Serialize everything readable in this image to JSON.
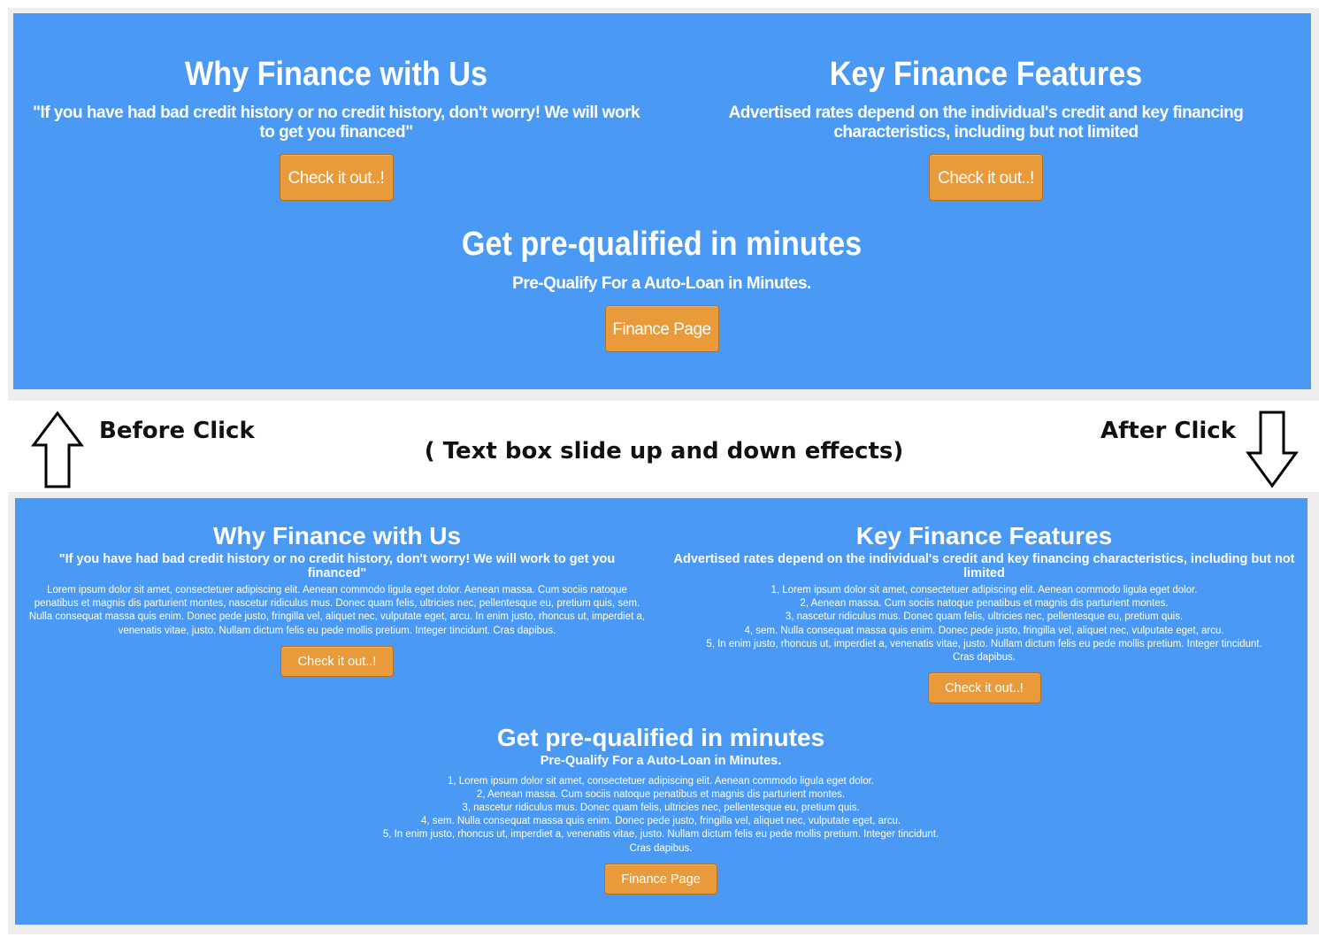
{
  "before_panel": {
    "left": {
      "title": "Why Finance with Us",
      "subtitle": "\"If you have had bad credit history or no credit history, don't worry! We will work to get you financed\"",
      "button": "Check it out..!"
    },
    "right": {
      "title": "Key Finance Features",
      "subtitle": "Advertised rates depend on the individual's credit and key financing characteristics, including but not limited",
      "button": "Check it out..!"
    },
    "center": {
      "title": "Get pre-qualified in minutes",
      "subtitle": "Pre-Qualify For a Auto-Loan in Minutes.",
      "button": "Finance Page"
    }
  },
  "labels": {
    "before": "Before Click",
    "after": "After Click",
    "caption": "( Text box slide up and down effects)",
    "up_arrow_icon": "arrow-up-outline",
    "down_arrow_icon": "arrow-down-outline"
  },
  "after_panel": {
    "left": {
      "title": "Why Finance with Us",
      "subtitle": "\"If you have had bad credit history or no credit history, don't worry! We will work to get you financed\"",
      "body": "Lorem ipsum dolor sit amet, consectetuer adipiscing elit. Aenean commodo ligula eget dolor. Aenean massa. Cum sociis natoque penatibus et magnis dis parturient montes, nascetur ridiculus mus. Donec quam felis, ultricies nec, pellentesque eu, pretium quis, sem. Nulla consequat massa quis enim. Donec pede justo, fringilla vel, aliquet nec, vulputate eget, arcu. In enim justo, rhoncus ut, imperdiet a, venenatis vitae, justo. Nullam dictum felis eu pede mollis pretium. Integer tincidunt. Cras dapibus.",
      "button": "Check it out..!"
    },
    "right": {
      "title": "Key Finance Features",
      "subtitle": "Advertised rates depend on the individual's credit and key financing characteristics, including but not limited",
      "lines": [
        "1, Lorem ipsum dolor sit amet, consectetuer adipiscing elit. Aenean commodo ligula eget dolor.",
        "2, Aenean massa. Cum sociis natoque penatibus et magnis dis parturient montes.",
        "3, nascetur ridiculus mus. Donec quam felis, ultricies nec, pellentesque eu, pretium quis.",
        "4, sem. Nulla consequat massa quis enim. Donec pede justo, fringilla vel, aliquet nec, vulputate eget, arcu.",
        "5, In enim justo, rhoncus ut, imperdiet a, venenatis vitae, justo. Nullam dictum felis eu pede mollis pretium. Integer tincidunt.",
        "Cras dapibus."
      ],
      "button": "Check it out..!"
    },
    "center": {
      "title": "Get pre-qualified in minutes",
      "subtitle": "Pre-Qualify For a Auto-Loan in Minutes.",
      "lines": [
        "1, Lorem ipsum dolor sit amet, consectetuer adipiscing elit. Aenean commodo ligula eget dolor.",
        "2, Aenean massa. Cum sociis natoque penatibus et magnis dis parturient montes.",
        "3, nascetur ridiculus mus. Donec quam felis, ultricies nec, pellentesque eu, pretium quis.",
        "4, sem. Nulla consequat massa quis enim. Donec pede justo, fringilla vel, aliquet nec, vulputate eget, arcu.",
        "5, In enim justo, rhoncus ut, imperdiet a, venenatis vitae, justo. Nullam dictum felis eu pede mollis pretium. Integer tincidunt.",
        "Cras dapibus."
      ],
      "button": "Finance Page"
    }
  },
  "colors": {
    "panel_bg": "#4a99f5",
    "button_bg": "#e99b3c",
    "button_border": "#b06f22"
  }
}
